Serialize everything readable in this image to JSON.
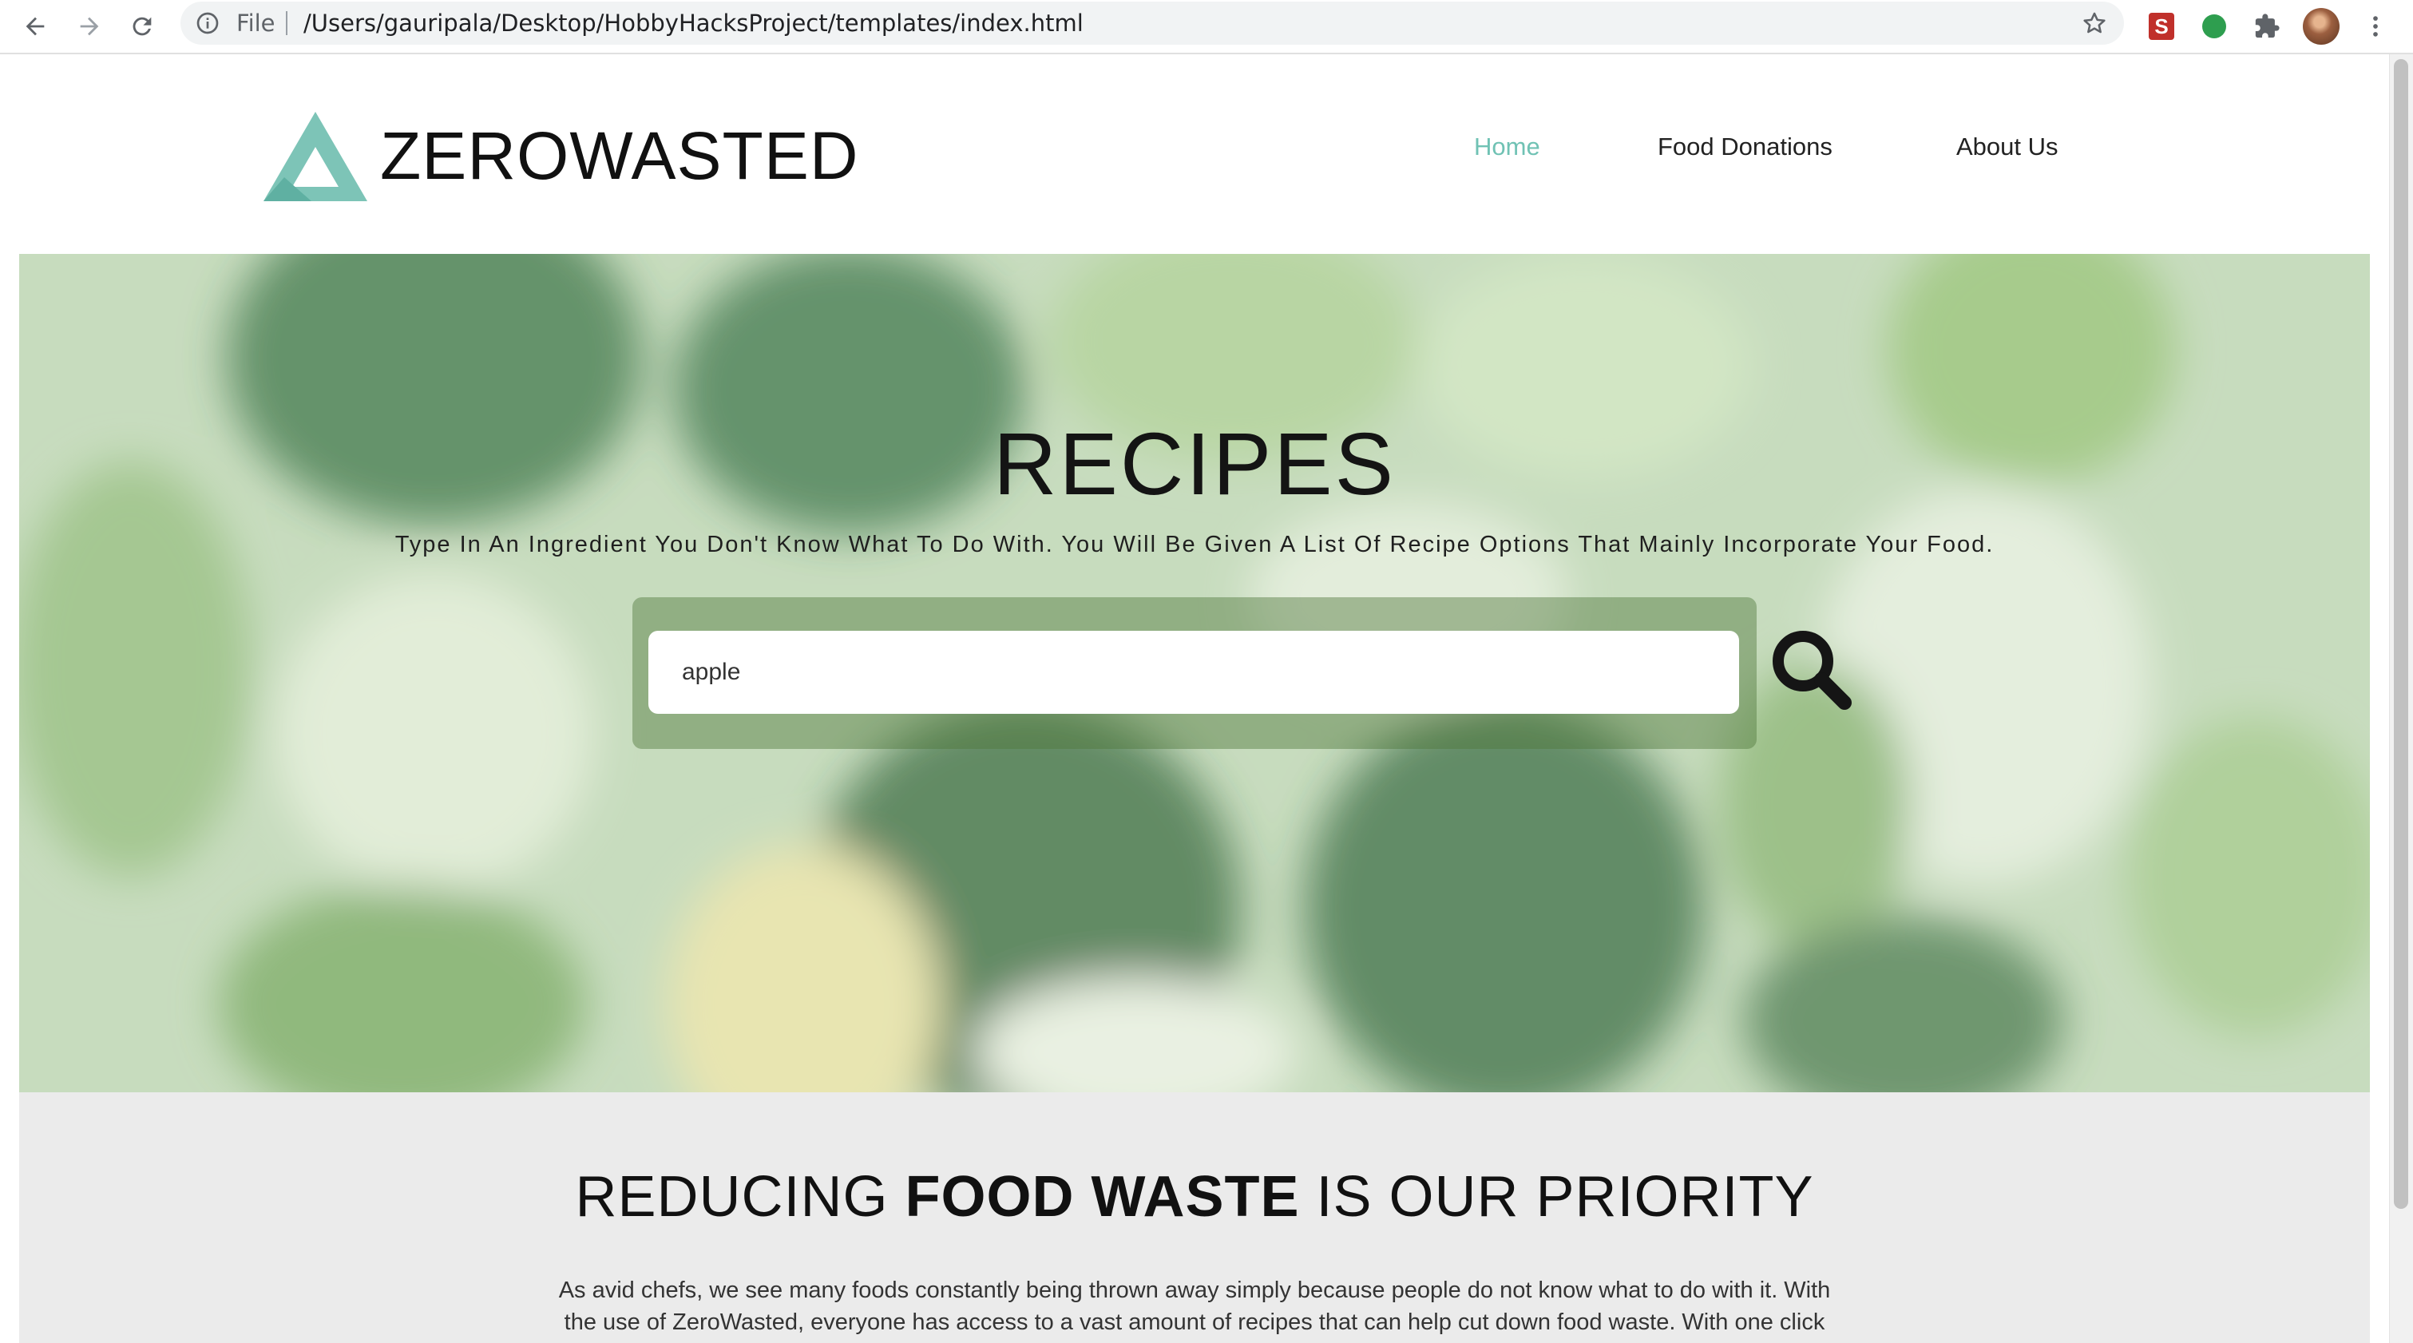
{
  "browser": {
    "file_label": "File",
    "url": "/Users/gauripala/Desktop/HobbyHacksProject/templates/index.html",
    "extension_s_label": "S",
    "icons": [
      "back-icon",
      "forward-icon",
      "reload-icon",
      "info-icon",
      "star-icon",
      "extension-s-icon",
      "extension-green-dot-icon",
      "puzzle-icon",
      "kebab-menu-icon"
    ]
  },
  "site": {
    "logo_text": "ZEROWASTED",
    "nav": {
      "home": "Home",
      "food_donations": "Food Donations",
      "about_us": "About Us"
    },
    "accent_color": "#70c2b4"
  },
  "hero": {
    "title": "RECIPES",
    "subtitle": "Type In An Ingredient You Don't Know What To Do With. You Will Be Given A List Of Recipe Options That Mainly Incorporate Your Food.",
    "search_value": "apple"
  },
  "about": {
    "heading_pre": "REDUCING ",
    "heading_bold": "FOOD WASTE",
    "heading_post": " IS OUR PRIORITY",
    "line1": "As avid chefs, we see many foods constantly being thrown away simply because people do not know what to do with it. With",
    "line2": "the use of ZeroWasted, everyone has access to a vast amount of recipes that can help cut down food waste. With one click"
  }
}
